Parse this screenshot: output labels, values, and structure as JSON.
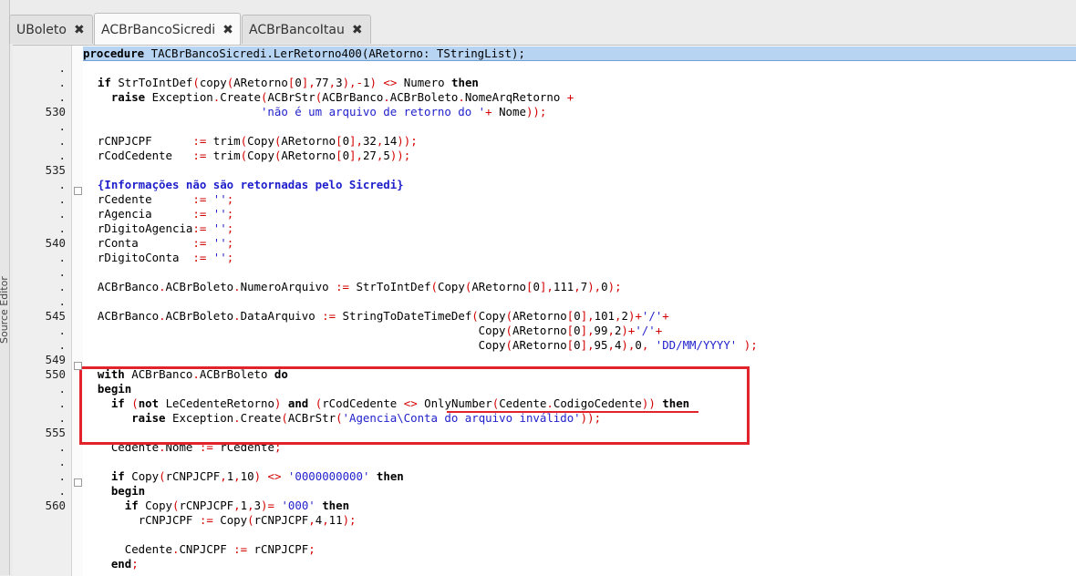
{
  "side_panel": {
    "label": "Source Editor"
  },
  "tabs": [
    {
      "label": "UBoleto",
      "active": false
    },
    {
      "label": "ACBrBancoSicredi",
      "active": true
    },
    {
      "label": "ACBrBancoItau",
      "active": false
    }
  ],
  "gutter": [
    ".",
    ".",
    ".",
    "530",
    ".",
    ".",
    ".",
    "535",
    ".",
    ".",
    ".",
    ".",
    "540",
    ".",
    ".",
    ".",
    ".",
    "545",
    ".",
    ".",
    "549",
    "550",
    ".",
    ".",
    ".",
    "555",
    ".",
    ".",
    ".",
    ".",
    "560"
  ],
  "header_line": "procedure TACBrBancoSicredi.LerRetorno400(ARetorno: TStringList);",
  "code": [
    "",
    "  if StrToIntDef(copy(ARetorno[0],77,3),-1) <> Numero then",
    "    raise Exception.Create(ACBrStr(ACBrBanco.ACBrBoleto.NomeArqRetorno +",
    "                          'não é um arquivo de retorno do '+ Nome));",
    "",
    "  rCNPJCPF      := trim(Copy(ARetorno[0],32,14));",
    "  rCodCedente   := trim(Copy(ARetorno[0],27,5));",
    "",
    "  {Informações não são retornadas pelo Sicredi}",
    "  rCedente      := '';",
    "  rAgencia      := '';",
    "  rDigitoAgencia:= '';",
    "  rConta        := '';",
    "  rDigitoConta  := '';",
    "",
    "  ACBrBanco.ACBrBoleto.NumeroArquivo := StrToIntDef(Copy(ARetorno[0],111,7),0);",
    "",
    "  ACBrBanco.ACBrBoleto.DataArquivo := StringToDateTimeDef(Copy(ARetorno[0],101,2)+'/'+",
    "                                                          Copy(ARetorno[0],99,2)+'/'+",
    "                                                          Copy(ARetorno[0],95,4),0, 'DD/MM/YYYY' );",
    "",
    "  with ACBrBanco.ACBrBoleto do",
    "  begin",
    "    if (not LeCedenteRetorno) and (rCodCedente <> OnlyNumber(Cedente.CodigoCedente)) then",
    "       raise Exception.Create(ACBrStr('Agencia\\Conta do arquivo inválido'));",
    "",
    "    Cedente.Nome := rCedente;",
    "",
    "    if Copy(rCNPJCPF,1,10) <> '0000000000' then",
    "    begin",
    "      if Copy(rCNPJCPF,1,3)= '000' then",
    "        rCNPJCPF := Copy(rCNPJCPF,4,11);",
    "",
    "      Cedente.CNPJCPF := rCNPJCPF;",
    "    end;"
  ],
  "colors": {
    "highlight": "#e3232b",
    "header_bg": "#b7d4f2",
    "keyword": "#000000",
    "operator": "#d40000",
    "string": "#2222cc"
  }
}
